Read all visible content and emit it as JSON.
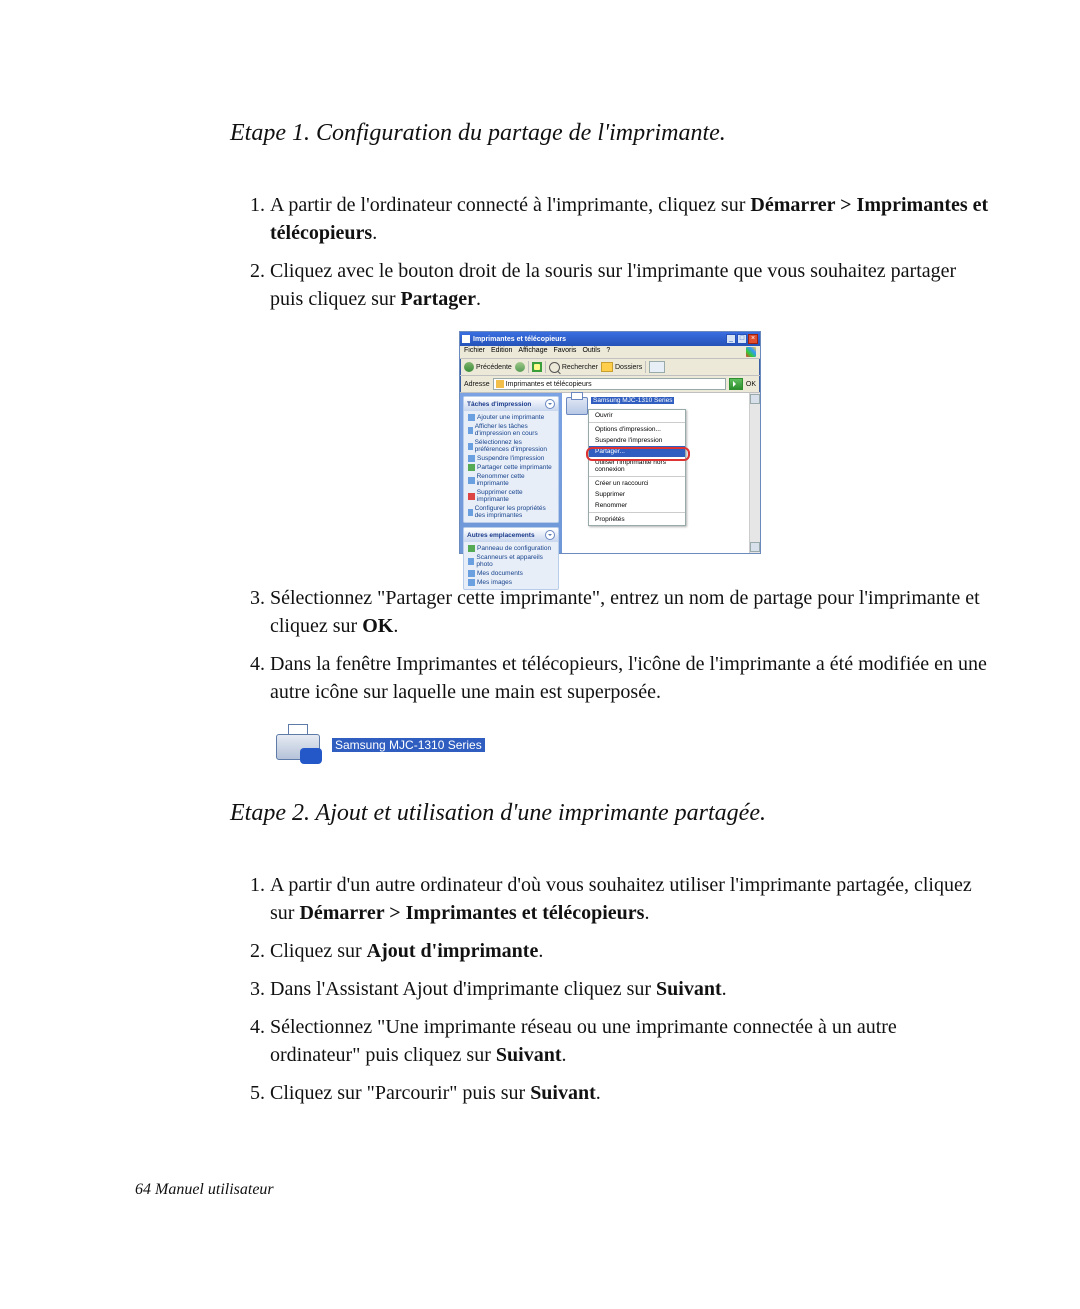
{
  "heading1": "Etape 1. Configuration du partage de l'imprimante.",
  "list1": {
    "i1_pre": "A partir de l'ordinateur connecté à l'imprimante, cliquez sur ",
    "i1_b": "Démarrer > Imprimantes et télécopieurs",
    "i1_post": ".",
    "i2_pre": "Cliquez avec le bouton droit de la souris sur l'imprimante que vous souhaitez partager puis cliquez sur ",
    "i2_b": "Partager",
    "i2_post": ".",
    "i3_pre": "Sélectionnez \"Partager cette imprimante\", entrez un nom de partage pour l'imprimante et cliquez sur ",
    "i3_b": "OK",
    "i3_post": ".",
    "i4": "Dans la fenêtre Imprimantes et télécopieurs, l'icône de l'imprimante a été modifiée en une autre icône sur laquelle une main est superposée."
  },
  "xp": {
    "title": "Imprimantes et télécopieurs",
    "menu": {
      "file": "Fichier",
      "edit": "Edition",
      "view": "Affichage",
      "fav": "Favoris",
      "tools": "Outils",
      "help": "?"
    },
    "toolbar": {
      "back": "Précédente",
      "search": "Rechercher",
      "folders": "Dossiers"
    },
    "addr_label": "Adresse",
    "addr_value": "Imprimantes et télécopieurs",
    "go": "OK",
    "tasks": {
      "header": "Tâches d'impression",
      "items": [
        "Ajouter une imprimante",
        "Afficher les tâches d'impression en cours",
        "Sélectionnez les préférences d'impression",
        "Suspendre l'impression",
        "Partager cette imprimante",
        "Renommer cette imprimante",
        "Supprimer cette imprimante",
        "Configurer les propriétés des imprimantes"
      ]
    },
    "other": {
      "header": "Autres emplacements",
      "items": [
        "Panneau de configuration",
        "Scanneurs et appareils photo",
        "Mes documents",
        "Mes images"
      ]
    },
    "printer_selected": "Samsung MJC-1310 Series",
    "ctx": {
      "open": "Ouvrir",
      "opts": "Options d'impression...",
      "suspend": "Suspendre l'impression",
      "share": "Partager...",
      "offline": "Utiliser l'imprimante hors connexion",
      "shortcut": "Créer un raccourci",
      "delete": "Supprimer",
      "rename": "Renommer",
      "props": "Propriétés"
    }
  },
  "shared_label": "Samsung MJC-1310 Series",
  "heading2": "Etape 2. Ajout et utilisation d'une imprimante partagée.",
  "list2": {
    "i1_pre": "A partir d'un autre ordinateur d'où vous souhaitez utiliser l'imprimante partagée, cliquez sur ",
    "i1_b": "Démarrer > Imprimantes et télécopieurs",
    "i1_post": ".",
    "i2_pre": "Cliquez sur ",
    "i2_b": "Ajout d'imprimante",
    "i2_post": ".",
    "i3_pre": "Dans l'Assistant Ajout d'imprimante cliquez sur ",
    "i3_b": "Suivant",
    "i3_post": ".",
    "i4_pre": "Sélectionnez \"Une imprimante réseau ou une imprimante connectée à un autre ordinateur\" puis cliquez sur ",
    "i4_b": "Suivant",
    "i4_post": ".",
    "i5_pre": "Cliquez sur \"Parcourir\" puis sur ",
    "i5_b": "Suivant",
    "i5_post": "."
  },
  "footer_page": "64",
  "footer_label": "Manuel utilisateur"
}
